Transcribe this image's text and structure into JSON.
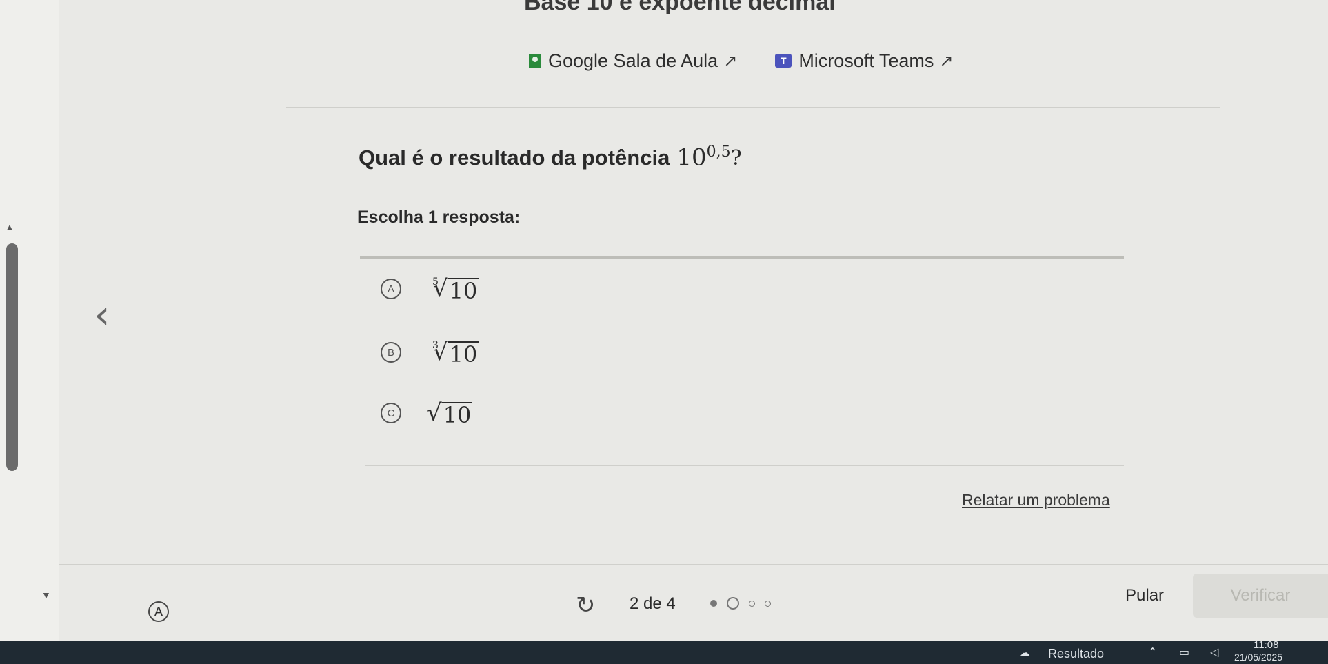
{
  "lesson": {
    "title": "Base 10 e expoente decimal"
  },
  "share": {
    "google_classroom": "Google Sala de Aula",
    "microsoft_teams": "Microsoft Teams"
  },
  "question": {
    "prompt": "Qual é o resultado da potência",
    "base": "10",
    "exponent": "0,5",
    "end": "?",
    "instruction": "Escolha 1 resposta:",
    "options": [
      {
        "letter": "A",
        "index": "5",
        "radicand": "10"
      },
      {
        "letter": "B",
        "index": "3",
        "radicand": "10"
      },
      {
        "letter": "C",
        "index": "",
        "radicand": "10"
      }
    ]
  },
  "report_link": "Relatar um problema",
  "footer": {
    "avatar_letter": "A",
    "progress": "2 de 4",
    "progress_current": 2,
    "progress_total": 4,
    "skip_label": "Pular",
    "verify_label": "Verificar"
  },
  "taskbar": {
    "weather_label": "Resultado",
    "time": "11:08",
    "date": "21/05/2025"
  },
  "icons": {
    "back": "chevron-left-icon",
    "retry": "retry-icon",
    "external": "external-link-icon"
  },
  "colors": {
    "google_classroom": "#2a8a3b",
    "teams": "#4b53bc",
    "verify_disabled_bg": "#dcdcd8"
  }
}
